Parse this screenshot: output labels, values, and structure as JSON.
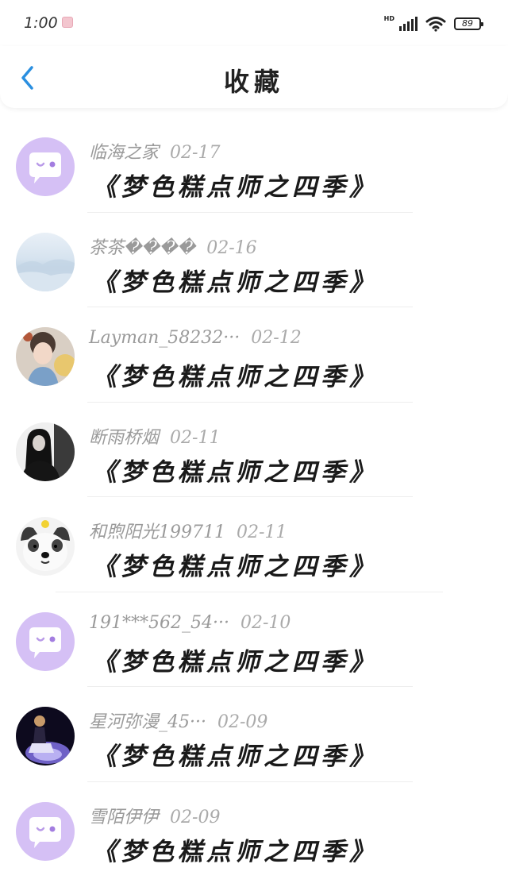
{
  "status": {
    "time": "1:00",
    "network": "HD",
    "battery": "89"
  },
  "header": {
    "title": "收藏"
  },
  "favorites": [
    {
      "user": "临海之家",
      "date": "02-17",
      "title": "《梦色糕点师之四季》",
      "avatar": "default-avatar-icon"
    },
    {
      "user": "茶茶����",
      "date": "02-16",
      "title": "《梦色糕点师之四季》",
      "avatar": "landscape-avatar"
    },
    {
      "user": "Layman_58232···",
      "date": "02-12",
      "title": "《梦色糕点师之四季》",
      "avatar": "anime-girl-avatar"
    },
    {
      "user": "断雨桥烟",
      "date": "02-11",
      "title": "《梦色糕点师之四季》",
      "avatar": "girl-photo-avatar"
    },
    {
      "user": "和煦阳光199711",
      "date": "02-11",
      "title": "《梦色糕点师之四季》",
      "avatar": "dog-avatar"
    },
    {
      "user": "191***562_54···",
      "date": "02-10",
      "title": "《梦色糕点师之四季》",
      "avatar": "default-avatar-icon"
    },
    {
      "user": "星河弥漫_45···",
      "date": "02-09",
      "title": "《梦色糕点师之四季》",
      "avatar": "night-figure-avatar"
    },
    {
      "user": "雪陌伊伊",
      "date": "02-09",
      "title": "《梦色糕点师之四季》",
      "avatar": "default-avatar-icon"
    }
  ],
  "colors": {
    "accent": "#2a8fe0",
    "default_avatar": "#d5c0f5"
  }
}
